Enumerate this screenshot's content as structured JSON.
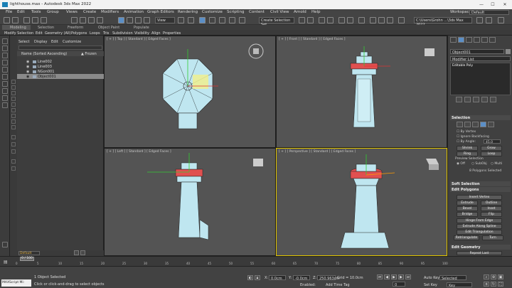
{
  "window": {
    "title": "lighthouse.max - Autodesk 3ds Max 2022",
    "minimize": "—",
    "maximize": "☐",
    "close": "✕"
  },
  "menu": [
    "File",
    "Edit",
    "Tools",
    "Group",
    "Views",
    "Create",
    "Modifiers",
    "Animation",
    "Graph Editors",
    "Rendering",
    "Customize",
    "Scripting",
    "Content",
    "Civil View",
    "Arnold",
    "Help"
  ],
  "menu_right": {
    "workspaces_label": "Workspaces:",
    "workspaces_value": "Default"
  },
  "toolbar": {
    "view_dropdown": "View",
    "selection_set": "Create Selection Set",
    "path_field": "C:\\Users\\Grohn ...\\3ds Max 2022"
  },
  "ribbon": {
    "tabs": [
      "Modeling",
      "Selection",
      "Freeform",
      "Object Paint",
      "Populate"
    ],
    "items": [
      "Modify Selection",
      "Edit",
      "Geometry (All)",
      "Polygons",
      "Loops",
      "Tris",
      "Subdivision",
      "Visibility",
      "Align",
      "Properties"
    ]
  },
  "scene_explorer": {
    "tabs": [
      "Select",
      "Display",
      "Edit",
      "Customize"
    ],
    "column_name": "Name (Sorted Ascending)",
    "column_frozen": "▲ Frozen",
    "rows": [
      {
        "name": "Line002",
        "selected": false
      },
      {
        "name": "Line003",
        "selected": false
      },
      {
        "name": "NGon001",
        "selected": false
      },
      {
        "name": "Object001",
        "selected": true
      }
    ],
    "layer": "Default"
  },
  "viewports": {
    "top": "[ + ] [ Top ] [ Standard ] [ Edged Faces ]",
    "front": "[ + ] [ Front ] [ Standard ] [ Edged Faces ]",
    "left": "[ + ] [ Left ] [ Standard ] [ Edged Faces ]",
    "perspective": "[ + ] [ Perspective ] [ Standard ] [ Edged Faces ]"
  },
  "command_panel": {
    "object_name": "Object001",
    "modifier_list": "Modifier List",
    "stack_item": "Editable Poly",
    "selection_header": "Selection",
    "by_vertex": "By Vertex",
    "ignore_backfacing": "Ignore Backfacing",
    "by_angle": "By Angle:",
    "by_angle_value": "45.0",
    "shrink": "Shrink",
    "grow": "Grow",
    "ring": "Ring",
    "loop": "Loop",
    "preview_selection": "Preview Selection",
    "preview_off": "Off",
    "preview_subobj": "SubObj",
    "preview_multi": "Multi",
    "selection_count": "8 Polygons Selected",
    "soft_selection": "Soft Selection",
    "edit_polygons": "Edit Polygons",
    "insert_vertex": "Insert Vertex",
    "extrude": "Extrude",
    "outline": "Outline",
    "bevel": "Bevel",
    "inset": "Inset",
    "bridge": "Bridge",
    "flip": "Flip",
    "hinge_from_edge": "Hinge From Edge",
    "extrude_along_spline": "Extrude Along Spline",
    "edit_triangulation": "Edit Triangulation",
    "retriangulate": "Retriangulate",
    "turn": "Turn",
    "edit_geometry": "Edit Geometry",
    "repeat_last": "Repeat Last"
  },
  "timeline": {
    "slider": "0 / 100",
    "ticks": [
      "0",
      "5",
      "10",
      "15",
      "20",
      "25",
      "30",
      "35",
      "40",
      "45",
      "50",
      "55",
      "60",
      "65",
      "70",
      "75",
      "80",
      "85",
      "90",
      "95",
      "100"
    ]
  },
  "status": {
    "maxscript": "MAXScript Mi:",
    "selected": "1 Object Selected",
    "prompt": "Click or click-and-drag to select objects",
    "x_label": "X:",
    "x_value": "0.0cm",
    "y_label": "Y:",
    "y_value": "-0.0cm",
    "z_label": "Z:",
    "z_value": "250.963cm",
    "grid": "Grid = 10.0cm",
    "enabled": "Enabled:",
    "add_time_tag": "Add Time Tag",
    "auto_key": "Auto Key",
    "set_key": "Set Key",
    "key_mode": "Selected",
    "key_filters": "Key Filters...",
    "frame": "0"
  },
  "colors": {
    "accent_active": "#e0c400",
    "selected_poly": "#e05050",
    "model": "#bfe6f0",
    "viewport_bg": "#545454"
  }
}
